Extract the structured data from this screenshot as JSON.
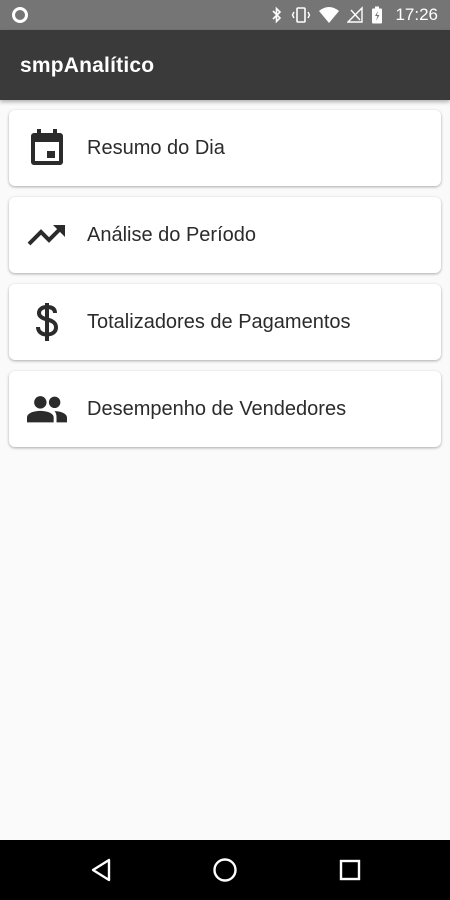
{
  "status_bar": {
    "time": "17:26"
  },
  "app_bar": {
    "title": "smpAnalítico"
  },
  "menu": {
    "items": [
      {
        "label": "Resumo do Dia",
        "icon": "calendar-icon"
      },
      {
        "label": "Análise do Período",
        "icon": "trending-up-icon"
      },
      {
        "label": "Totalizadores de Pagamentos",
        "icon": "dollar-icon"
      },
      {
        "label": "Desempenho de Vendedores",
        "icon": "people-icon"
      }
    ]
  },
  "colors": {
    "status_bar": "#757575",
    "app_bar": "#3a3a3a",
    "background": "#fafafa",
    "card": "#ffffff",
    "text": "#2b2b2b",
    "icon": "#2b2b2b"
  }
}
